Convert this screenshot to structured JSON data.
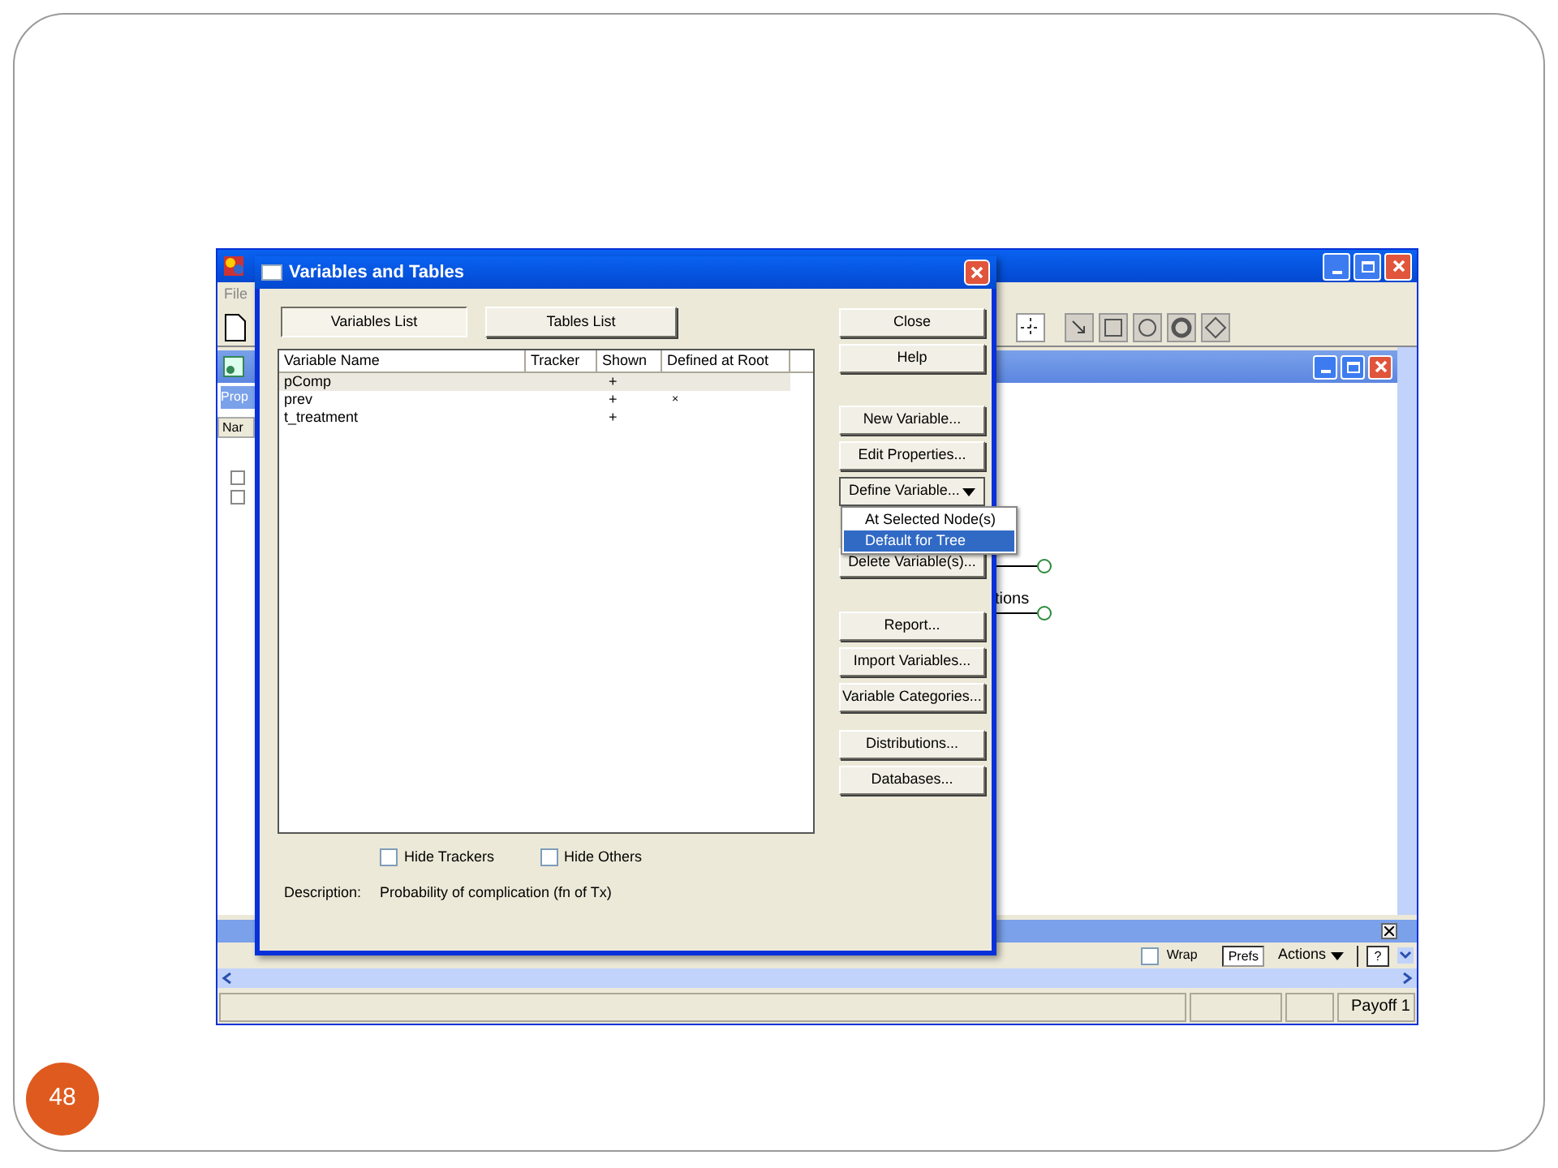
{
  "slide": {
    "page_number": "48"
  },
  "app": {
    "menu": [
      "File"
    ],
    "child_window": {
      "tab": "Prop",
      "column_header": "Nar",
      "node_label": "tions"
    },
    "bottom_pane": {
      "wrap": {
        "label": "Wrap",
        "checked": false
      },
      "prefs": "Prefs",
      "actions": "Actions",
      "help": "?"
    },
    "status_bar": {
      "payoff": "Payoff 1"
    }
  },
  "dialog": {
    "title": "Variables and Tables",
    "tabs": [
      {
        "label": "Variables List",
        "selected": true
      },
      {
        "label": "Tables List",
        "selected": false
      }
    ],
    "table": {
      "columns": [
        "Variable Name",
        "Tracker",
        "Shown",
        "Defined at Root"
      ],
      "rows": [
        {
          "name": "pComp",
          "shown": "+",
          "selected": true
        },
        {
          "name": "prev",
          "shown": "+",
          "defined_at_root": "×",
          "selected": false
        },
        {
          "name": "t_treatment",
          "shown": "+",
          "selected": false
        }
      ]
    },
    "button_groups": [
      [
        {
          "label": "Close",
          "kind": "button"
        },
        {
          "label": "Help",
          "kind": "button"
        }
      ],
      [
        {
          "label": "New Variable...",
          "kind": "button"
        },
        {
          "label": "Edit Properties...",
          "kind": "button"
        },
        {
          "label": "Define Variable...",
          "kind": "dropdown"
        },
        {
          "label": "Delete Variable(s)...",
          "kind": "button"
        }
      ],
      [
        {
          "label": "Report...",
          "kind": "button"
        },
        {
          "label": "Import Variables...",
          "kind": "button"
        },
        {
          "label": "Variable Categories...",
          "kind": "button"
        }
      ],
      [
        {
          "label": "Distributions...",
          "kind": "button"
        },
        {
          "label": "Databases...",
          "kind": "button"
        }
      ]
    ],
    "dropdown_menu": {
      "items": [
        {
          "label": "At Selected Node(s)",
          "selected": false
        },
        {
          "label": "Default for Tree",
          "selected": true
        }
      ]
    },
    "checkboxes": [
      {
        "label": "Hide Trackers",
        "checked": false
      },
      {
        "label": "Hide Others",
        "checked": false
      }
    ],
    "description": {
      "label": "Description:",
      "value": "Probability of complication (fn of Tx)"
    }
  }
}
